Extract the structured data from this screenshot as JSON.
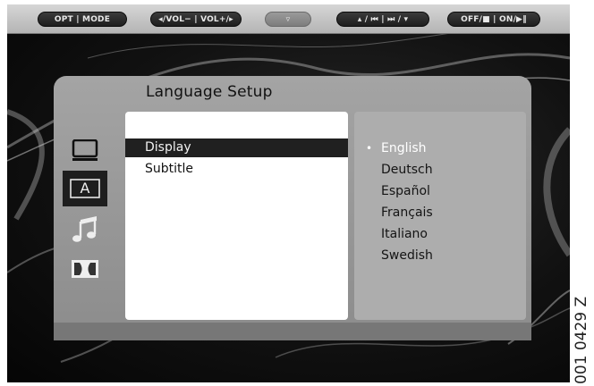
{
  "top_bar": {
    "buttons": [
      {
        "label": "OPT | MODE"
      },
      {
        "label": "◂/VOL− | VOL+/▸"
      },
      {
        "label": "▿"
      },
      {
        "label": "▴ / ⏮ | ⏭ / ▾"
      },
      {
        "label": "OFF/■ | ON/▶‖"
      }
    ]
  },
  "panel": {
    "title": "Language Setup",
    "tabs": [
      {
        "icon": "display-icon",
        "active": false
      },
      {
        "icon": "audio-language-icon",
        "label": "A",
        "active": true
      },
      {
        "icon": "music-icon",
        "active": false
      },
      {
        "icon": "dolby-icon",
        "active": false
      }
    ],
    "menu_items": [
      {
        "label": "Display",
        "selected": true
      },
      {
        "label": "Subtitle",
        "selected": false
      }
    ],
    "options": [
      {
        "label": "English",
        "current": true,
        "marker": "•"
      },
      {
        "label": "Deutsch",
        "current": false
      },
      {
        "label": "Español",
        "current": false
      },
      {
        "label": "Français",
        "current": false
      },
      {
        "label": "Italiano",
        "current": false
      },
      {
        "label": "Swedish",
        "current": false
      }
    ]
  },
  "side_code": "001 0429 Z",
  "colors": {
    "selected_row": "#202020",
    "panel": "#9a9a9a",
    "options_bg": "#adadad"
  }
}
